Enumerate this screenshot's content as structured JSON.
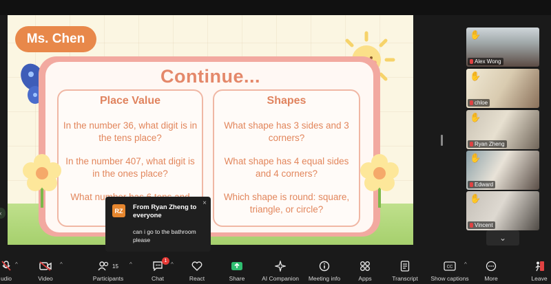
{
  "slide": {
    "teacher_name": "Ms. Chen",
    "title": "Continue...",
    "left_card": {
      "title": "Place Value",
      "q1": "In the number 36, what digit is in the tens place?",
      "q2": "In the number 407, what digit is in the ones place?",
      "q3": "What number has 6 tens and"
    },
    "right_card": {
      "title": "Shapes",
      "q1": "What shape has 3 sides and 3 corners?",
      "q2": "What shape has 4 equal sides and 4 corners?",
      "q3": "Which shape is round: square, triangle, or circle?"
    }
  },
  "chat_popup": {
    "avatar_initials": "RZ",
    "sender": "From Ryan Zheng to everyone",
    "message": "can i go to the bathroom please",
    "close": "×"
  },
  "gallery": {
    "participants": [
      {
        "name": "Alex Wong",
        "muted": true,
        "hand": true
      },
      {
        "name": "chloe",
        "muted": true,
        "hand": true
      },
      {
        "name": "Ryan Zheng",
        "muted": true,
        "hand": true
      },
      {
        "name": "Edward",
        "muted": true,
        "hand": true
      },
      {
        "name": "Vincent",
        "muted": true,
        "hand": true
      }
    ],
    "down_arrow": "⌄"
  },
  "toolbar": {
    "audio": "udio",
    "video": "Video",
    "participants": "Participants",
    "participants_count": "15",
    "chat": "Chat",
    "chat_badge": "1",
    "react": "React",
    "share": "Share",
    "ai_companion": "AI Companion",
    "meeting_info": "Meeting info",
    "apps": "Apps",
    "transcript": "Transcript",
    "show_captions": "Show captions",
    "more": "More",
    "leave": "Leave",
    "caret": "^"
  },
  "colors": {
    "accent_orange": "#e8884a",
    "share_green": "#2fbf71",
    "mic_off_red": "#e04242",
    "chat_badge_red": "#e53935"
  }
}
